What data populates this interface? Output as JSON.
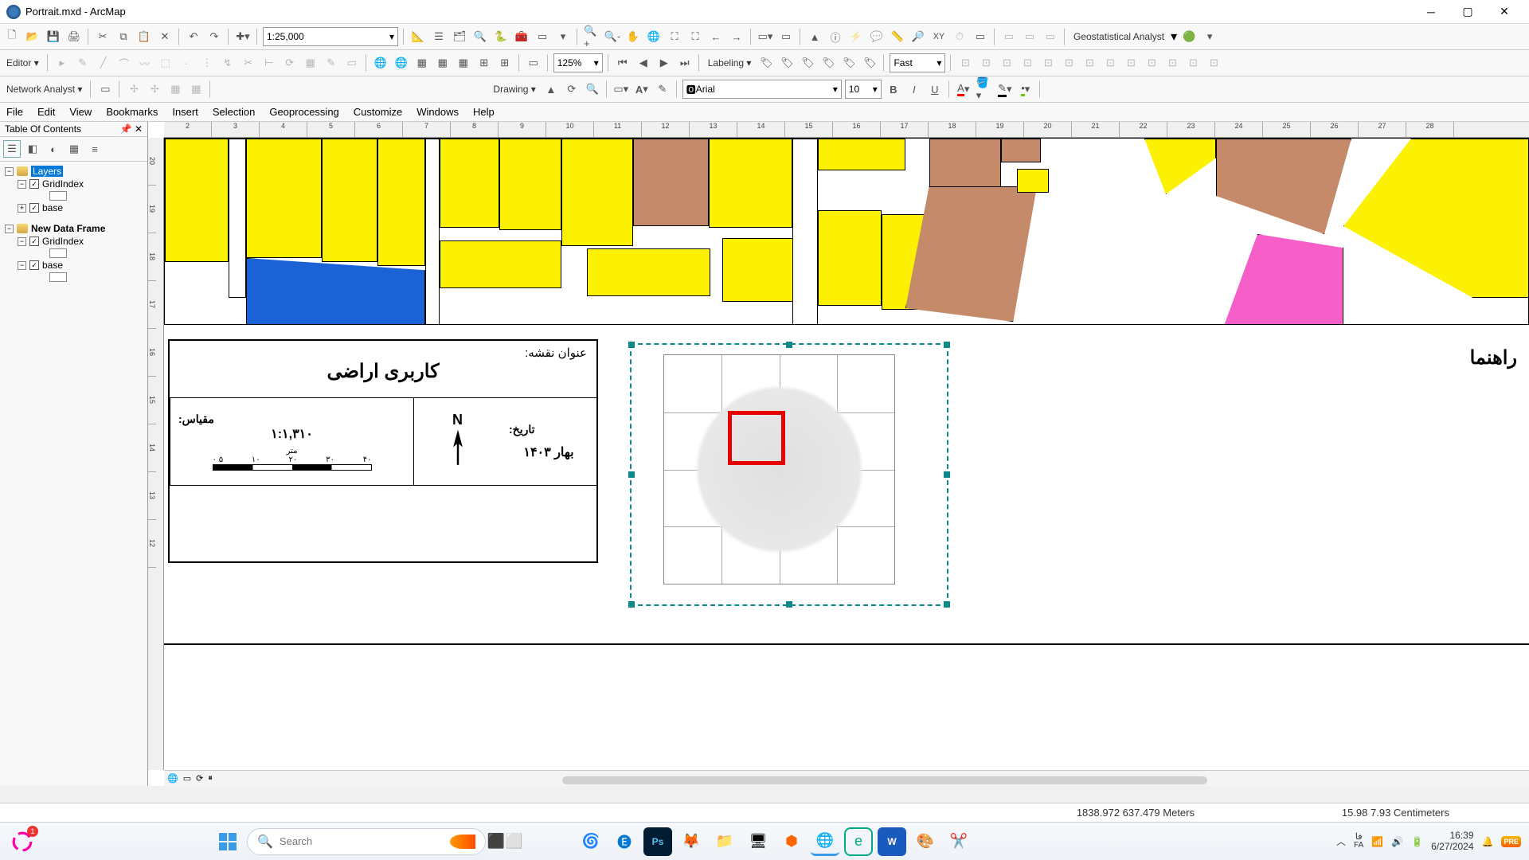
{
  "window": {
    "title": "Portrait.mxd - ArcMap"
  },
  "scale_combo": "1:25,000",
  "zoom_combo": "125%",
  "font_name": "Arial",
  "font_size": "10",
  "editor_label": "Editor",
  "network_label": "Network Analyst",
  "drawing_label": "Drawing",
  "labeling_label": "Labeling",
  "maplex_quality": "Fast",
  "geostat_label": "Geostatistical Analyst",
  "menus": [
    "File",
    "Edit",
    "View",
    "Bookmarks",
    "Insert",
    "Selection",
    "Geoprocessing",
    "Customize",
    "Windows",
    "Help"
  ],
  "toc": {
    "title": "Table Of Contents",
    "frames": [
      {
        "name": "Layers",
        "active": true,
        "layers": [
          {
            "name": "GridIndex",
            "checked": true
          },
          {
            "name": "base",
            "checked": true
          }
        ]
      },
      {
        "name": "New Data Frame",
        "active": false,
        "layers": [
          {
            "name": "GridIndex",
            "checked": true
          },
          {
            "name": "base",
            "checked": true
          }
        ]
      }
    ]
  },
  "ruler_h": [
    "2",
    "3",
    "4",
    "5",
    "6",
    "7",
    "8",
    "9",
    "10",
    "11",
    "12",
    "13",
    "14",
    "15",
    "16",
    "17",
    "18",
    "19",
    "20",
    "21",
    "22",
    "23",
    "24",
    "25",
    "26",
    "27",
    "28"
  ],
  "ruler_v": [
    "20",
    "19",
    "18",
    "17",
    "16",
    "15",
    "14",
    "13",
    "12"
  ],
  "legend_title": "راهنما",
  "titleblock": {
    "map_title_label": "عنوان نقشه:",
    "map_title_value": "کاربری اراضی",
    "date_label": "تاریخ:",
    "date_value": "بهار ۱۴۰۳",
    "north_label": "N",
    "scale_label": "مقیاس:",
    "scale_value": "۱:۱,۳۱۰",
    "scalebar_unit": "متر",
    "scalebar_ticks": [
      "۴۰",
      "۳۰",
      "۲۰",
      "۱۰",
      "۵ ۰"
    ]
  },
  "status": {
    "coords_map": "1838.972  637.479 Meters",
    "coords_page": "15.98  7.93 Centimeters"
  },
  "taskbar": {
    "search_placeholder": "Search",
    "lang_code": "فا",
    "lang_abbr": "FA",
    "time": "16:39",
    "date": "6/27/2024"
  }
}
